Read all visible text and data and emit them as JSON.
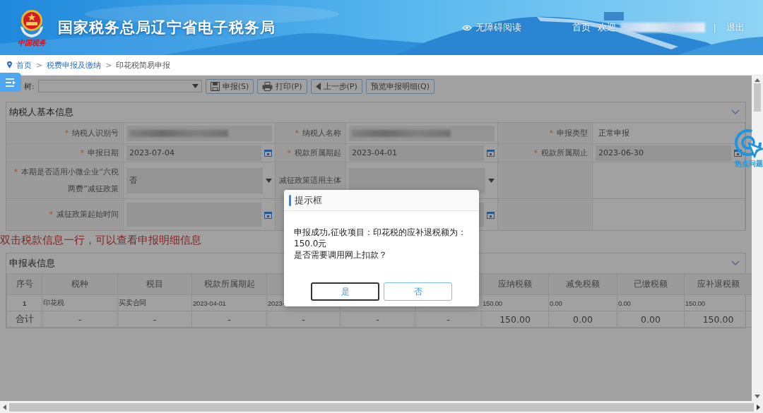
{
  "header": {
    "logo_text": "中国税务",
    "title": "国家税务总局辽宁省电子税务局",
    "accessibility_link": "无障碍阅读",
    "home_link": "首页",
    "welcome": "欢迎",
    "separator": "|",
    "logout": "退出"
  },
  "breadcrumb": [
    {
      "label": "首页",
      "link": true
    },
    {
      "label": "税费申报及缴纳",
      "link": true
    },
    {
      "label": "印花税简易申报",
      "link": false
    }
  ],
  "breadcrumb_separator": ">",
  "toolbar": {
    "tree_label": "树:",
    "buttons": [
      {
        "label": "申报(S)"
      },
      {
        "label": "打印(P)"
      },
      {
        "label": "上一步(P)"
      },
      {
        "label": "预览申报明细(Q)"
      }
    ]
  },
  "basic_info": {
    "title": "纳税人基本信息",
    "required_mark": "*",
    "fields": [
      {
        "label": "纳税人识别号",
        "required": true,
        "kind": "blurred"
      },
      {
        "label": "纳税人名称",
        "required": true,
        "kind": "blurred"
      },
      {
        "label": "申报类型",
        "required": true,
        "kind": "text",
        "value": "正常申报"
      },
      {
        "label": "申报日期",
        "required": true,
        "kind": "date",
        "value": "2023-07-04"
      },
      {
        "label": "税款所属期起",
        "required": true,
        "kind": "date",
        "value": "2023-04-01"
      },
      {
        "label": "税款所属期止",
        "required": true,
        "kind": "date",
        "value": "2023-06-30"
      },
      {
        "label": "本期是否适用小微企业“六税两费”减征政策",
        "required": true,
        "kind": "select",
        "value": "否"
      },
      {
        "label": "减征政策适用主体",
        "required": false,
        "kind": "select"
      },
      {
        "kind": "empty"
      },
      {
        "label": "减征政策起始时间",
        "required": true,
        "kind": "date"
      },
      {
        "kind": "date"
      },
      {
        "kind": "empty"
      }
    ]
  },
  "note": "双击税款信息一行，可以查看申报明细信息",
  "declaration": {
    "title": "申报表信息",
    "columns": [
      {
        "label": "序号"
      },
      {
        "label": "税种"
      },
      {
        "label": "税目"
      },
      {
        "label": "税款所属期起"
      },
      {},
      {},
      {},
      {
        "label": "应纳税额"
      },
      {
        "label": "减免税额"
      },
      {
        "label": "已缴税额"
      },
      {
        "label": "应补退税额"
      }
    ],
    "rows": [
      {
        "kind": "data",
        "cells": [
          "1",
          "印花税",
          "买卖合同",
          "2023-04-01",
          "2023-",
          null,
          null,
          "150.00",
          "0.00",
          "0.00",
          "150.00"
        ]
      },
      {
        "kind": "total",
        "cells": [
          "合计",
          "-",
          "-",
          "-",
          "-",
          "-",
          "-",
          "150.00",
          "0.00",
          "0.00",
          "150.00"
        ]
      }
    ]
  },
  "hot_issues": "热点问题",
  "dialog": {
    "title": "提示框",
    "message": [
      "申报成功,征收项目：印花税的应补退税额为：150.0元",
      "是否需要调用网上扣款？"
    ],
    "buttons": [
      {
        "label": "是",
        "focused": true
      },
      {
        "label": "否",
        "focused": false
      }
    ]
  }
}
